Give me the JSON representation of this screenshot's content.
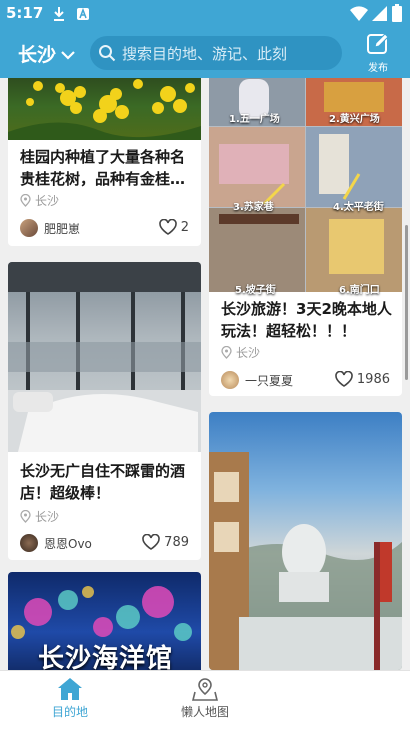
{
  "status": {
    "time": "5:17"
  },
  "header": {
    "city": "长沙",
    "search_placeholder": "搜索目的地、游记、此刻",
    "publish_label": "发布"
  },
  "feed": {
    "left": [
      {
        "title": "桂园内种植了大量各种名贵桂花树，品种有金桂…",
        "location": "长沙",
        "user": "肥肥崽",
        "likes": "2"
      },
      {
        "title": "长沙无广自住不踩雷的酒店！超级棒！",
        "location": "长沙",
        "user": "恩恩Ovo",
        "likes": "789"
      },
      {
        "image_text": "长沙海洋馆"
      }
    ],
    "right": [
      {
        "title": "长沙旅游！3天2晚本地人玩法！超轻松！！！",
        "location": "长沙",
        "user": "一只夏夏",
        "likes": "1986",
        "image_labels": [
          "1.五一广场",
          "2.黄兴广场",
          "3.苏家巷",
          "4.太平老街",
          "5.坡子街",
          "6.南门口"
        ]
      },
      {
        "image_text": ""
      }
    ]
  },
  "tabs": [
    {
      "label": "目的地",
      "active": true
    },
    {
      "label": "懒人地图",
      "active": false
    }
  ],
  "colors": {
    "primary": "#3fa6d4",
    "active_tab": "#3fa6d4"
  }
}
